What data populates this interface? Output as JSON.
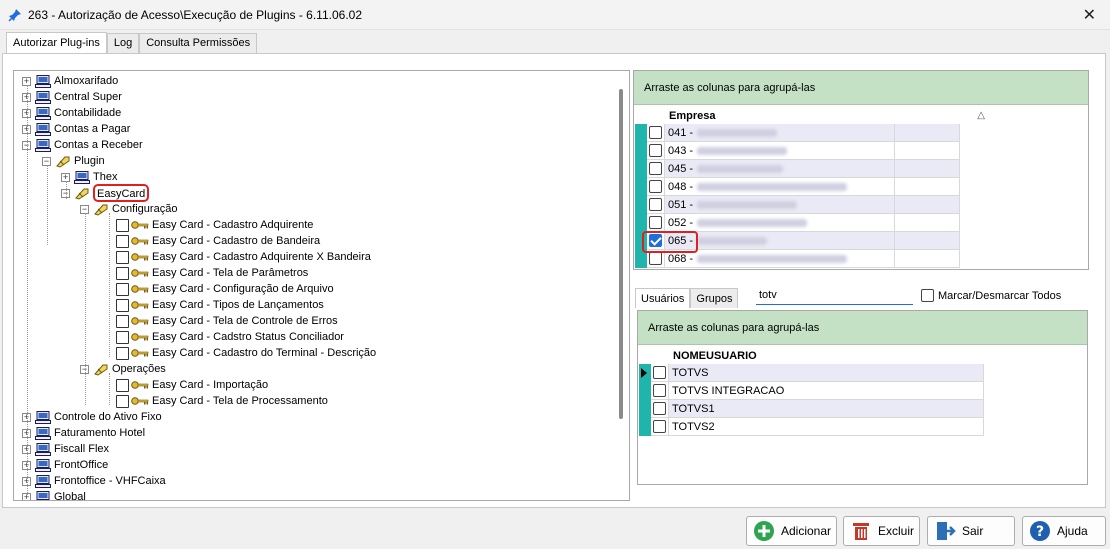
{
  "window": {
    "title": "263 - Autorização de Acesso\\Execução de Plugins - 6.11.06.02",
    "close_glyph": "✕"
  },
  "tabs": [
    {
      "label": "Autorizar Plug-ins"
    },
    {
      "label": "Log"
    },
    {
      "label": "Consulta Permissões"
    }
  ],
  "tree": {
    "top_items_before": [
      "Almoxarifado",
      "Central Super",
      "Contabilidade",
      "Contas a Pagar",
      "Contas a Receber"
    ],
    "plugin": "Plugin",
    "thex": "Thex",
    "easycard": "EasyCard",
    "configuracao": "Configuração",
    "config_items": [
      "Easy Card - Cadastro Adquirente",
      "Easy Card - Cadastro de Bandeira",
      "Easy Card - Cadastro Adquirente X Bandeira",
      "Easy Card - Tela de Parâmetros",
      "Easy Card - Configuração de Arquivo",
      "Easy Card - Tipos de Lançamentos",
      "Easy Card - Tela de Controle de Erros",
      "Easy Card - Cadstro Status Conciliador",
      "Easy Card - Cadastro do Terminal - Descrição"
    ],
    "operacoes": "Operações",
    "op_items": [
      "Easy Card - Importação",
      "Easy Card - Tela de Processamento"
    ],
    "top_items_after": [
      "Controle do Ativo Fixo",
      "Faturamento Hotel",
      "Fiscall Flex",
      "FrontOffice",
      "Frontoffice - VHFCaixa",
      "Global"
    ]
  },
  "empresa_grid": {
    "group_hint": "Arraste as colunas para agrupá-las",
    "column": "Empresa",
    "sort_glyph": "△",
    "rows": [
      {
        "code": "041 -",
        "checked": false
      },
      {
        "code": "043 -",
        "checked": false
      },
      {
        "code": "045 -",
        "checked": false
      },
      {
        "code": "048 -",
        "checked": false
      },
      {
        "code": "051 -",
        "checked": false
      },
      {
        "code": "052 -",
        "checked": false
      },
      {
        "code": "065 -",
        "checked": true
      },
      {
        "code": "068 -",
        "checked": false
      }
    ]
  },
  "user_tabs": [
    {
      "label": "Usuários"
    },
    {
      "label": "Grupos"
    }
  ],
  "search": {
    "value": "totv"
  },
  "mark_all_label": "Marcar/Desmarcar Todos",
  "user_grid": {
    "group_hint": "Arraste as colunas para agrupá-las",
    "column": "NOMEUSUARIO",
    "rows": [
      "TOTVS",
      "TOTVS INTEGRACAO",
      "TOTVS1",
      "TOTVS2"
    ]
  },
  "buttons": {
    "add": "Adicionar",
    "delete": "Excluir",
    "exit": "Sair",
    "help": "Ajuda"
  },
  "colors": {
    "accent": "#1e6fd9",
    "group_bar": "#c5e1c5",
    "indicator": "#1fb5ad",
    "highlight": "#e02020"
  }
}
